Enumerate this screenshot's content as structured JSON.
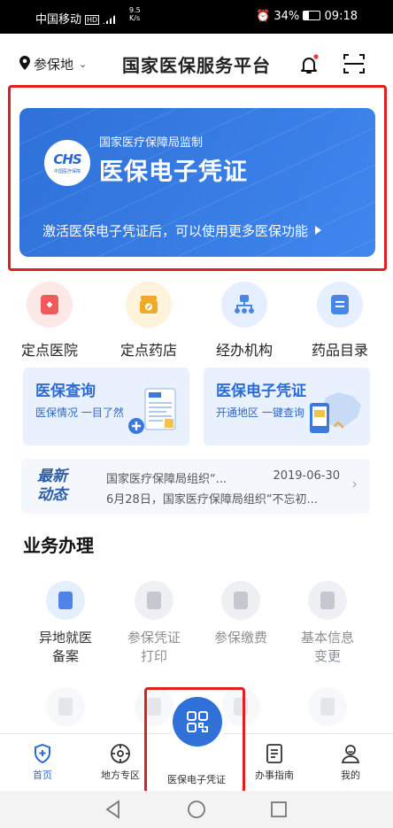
{
  "status_bar": {
    "carrier": "中国移动",
    "network_speed": "9.5",
    "network_unit": "K/s",
    "battery": "34%",
    "time": "09:18"
  },
  "header": {
    "location_label": "参保地",
    "title": "国家医保服务平台"
  },
  "banner": {
    "logo_text": "CHS",
    "logo_subtext": "中国医疗保障",
    "supervision": "国家医疗保障局监制",
    "title": "医保电子凭证",
    "hint": "激活医保电子凭证后，可以使用更多医保功能"
  },
  "quick_links": [
    {
      "label": "定点医院",
      "color": "#f05a5a",
      "bg": "#fde8e8"
    },
    {
      "label": "定点药店",
      "color": "#f0a929",
      "bg": "#fff3dc"
    },
    {
      "label": "经办机构",
      "color": "#4a86e8",
      "bg": "#e6efff"
    },
    {
      "label": "药品目录",
      "color": "#4a86e8",
      "bg": "#e6efff"
    }
  ],
  "cards": [
    {
      "title": "医保查询",
      "desc": "医保情况 一目了然"
    },
    {
      "title": "医保电子凭证",
      "desc": "开通地区 一键查询"
    }
  ],
  "news": {
    "tag_line1": "最新",
    "tag_line2": "动态",
    "headline": "国家医疗保障局组织“...",
    "date": "2019-06-30",
    "summary": "6月28日，国家医疗保障局组织“不忘初..."
  },
  "services": {
    "title": "业务办理",
    "items": [
      {
        "label_line1": "异地就医",
        "label_line2": "备案",
        "active": true
      },
      {
        "label_line1": "参保凭证",
        "label_line2": "打印",
        "active": false
      },
      {
        "label_line1": "参保缴费",
        "label_line2": "",
        "active": false
      },
      {
        "label_line1": "基本信息",
        "label_line2": "变更",
        "active": false
      }
    ]
  },
  "tabbar": {
    "home": "首页",
    "local": "地方专区",
    "ecert": "医保电子凭证",
    "guide": "办事指南",
    "mine": "我的"
  },
  "colors": {
    "primary": "#2f71d8",
    "highlight_border": "#e21e1e"
  }
}
